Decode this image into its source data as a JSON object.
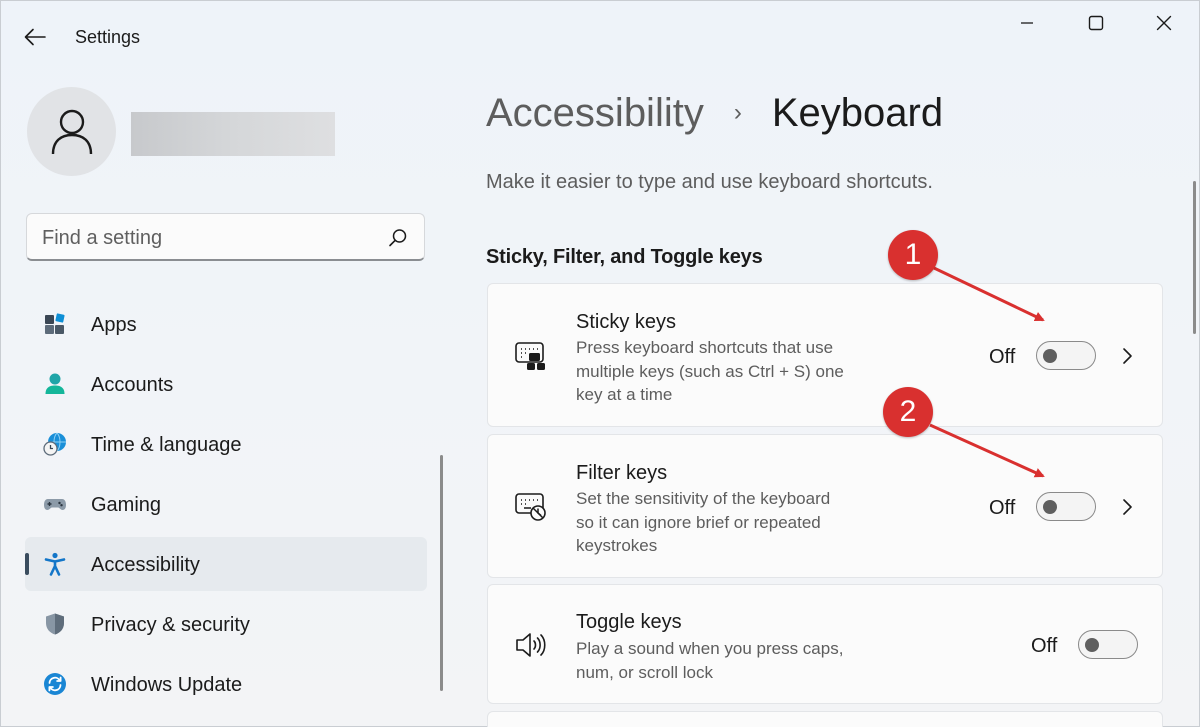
{
  "window": {
    "title": "Settings"
  },
  "search": {
    "placeholder": "Find a setting"
  },
  "sidebar": {
    "items": [
      {
        "label": "Apps",
        "icon": "apps-icon"
      },
      {
        "label": "Accounts",
        "icon": "accounts-icon"
      },
      {
        "label": "Time & language",
        "icon": "time-language-icon"
      },
      {
        "label": "Gaming",
        "icon": "gaming-icon"
      },
      {
        "label": "Accessibility",
        "icon": "accessibility-icon",
        "active": true
      },
      {
        "label": "Privacy & security",
        "icon": "shield-icon"
      },
      {
        "label": "Windows Update",
        "icon": "windows-update-icon"
      }
    ]
  },
  "main": {
    "breadcrumb": {
      "parent": "Accessibility",
      "separator": "›",
      "current": "Keyboard"
    },
    "description": "Make it easier to type and use keyboard shortcuts.",
    "section_title": "Sticky, Filter, and Toggle keys",
    "cards": [
      {
        "title": "Sticky keys",
        "description": "Press keyboard shortcuts that use multiple keys (such as Ctrl + S) one key at a time",
        "state": "Off",
        "icon": "sticky-keys-icon"
      },
      {
        "title": "Filter keys",
        "description": "Set the sensitivity of the keyboard so it can ignore brief or repeated keystrokes",
        "state": "Off",
        "icon": "filter-keys-icon"
      },
      {
        "title": "Toggle keys",
        "description": "Play a sound when you press caps, num, or scroll lock",
        "state": "Off",
        "icon": "speaker-icon"
      }
    ]
  },
  "annotations": [
    {
      "number": "1"
    },
    {
      "number": "2"
    }
  ],
  "colors": {
    "annotation_red": "#d9302f",
    "accent_teal": "#0e8fa8",
    "active_indicator": "#3a4c5e"
  }
}
